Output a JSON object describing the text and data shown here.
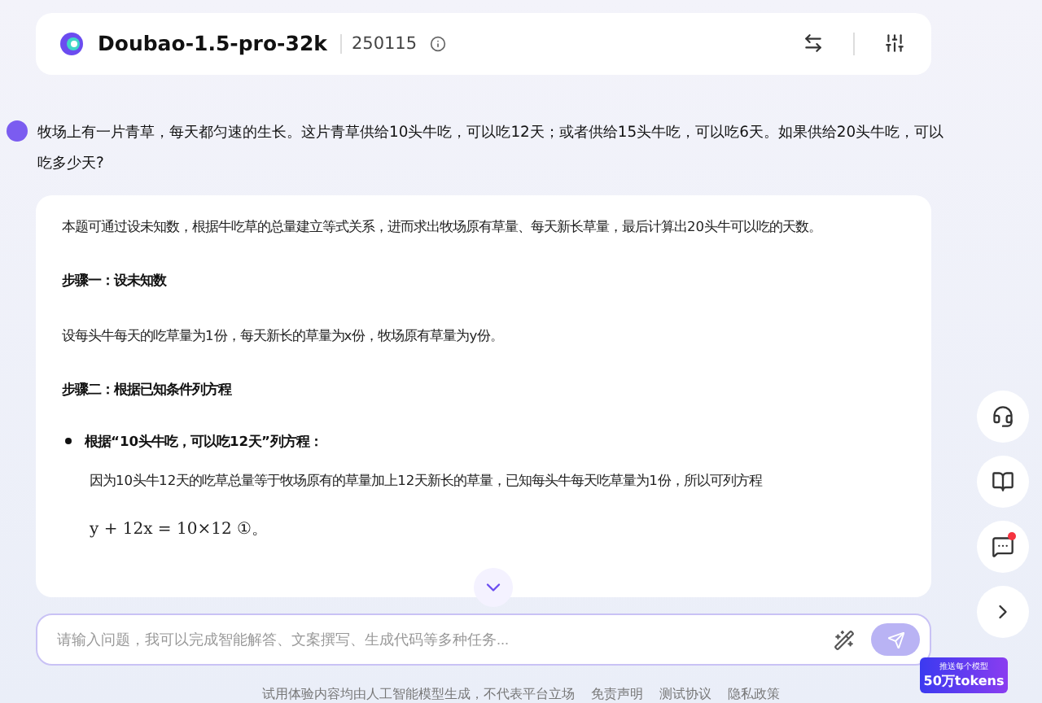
{
  "header": {
    "model_name": "Doubao-1.5-pro-32k",
    "version": "250115"
  },
  "question": {
    "text": "牧场上有一片青草，每天都匀速的生长。这片青草供给10头牛吃，可以吃12天；或者供给15头牛吃，可以吃6天。如果供给20头牛吃，可以吃多少天?"
  },
  "answer": {
    "blocks": [
      {
        "kind": "paragraph",
        "text": "本题可通过设未知数，根据牛吃草的总量建立等式关系，进而求出牧场原有草量、每天新长草量，最后计算出20头牛可以吃的天数。"
      },
      {
        "kind": "heading",
        "text": "步骤一：设未知数"
      },
      {
        "kind": "paragraph",
        "text": "设每头牛每天的吃草量为1份，每天新长的草量为x份，牧场原有草量为y份。"
      },
      {
        "kind": "heading",
        "text": "步骤二：根据已知条件列方程"
      },
      {
        "kind": "bullet",
        "text": "根据“10头牛吃，可以吃12天”列方程："
      },
      {
        "kind": "indented",
        "text": "因为10头牛12天的吃草总量等于牧场原有的草量加上12天新长的草量，已知每头牛每天吃草量为1份，所以可列方程"
      },
      {
        "kind": "formula",
        "text": "y + 12x = 10×12",
        "tag": "①",
        "end": "。"
      }
    ]
  },
  "input": {
    "placeholder": "请输入问题，我可以完成智能解答、文案撰写、生成代码等多种任务..."
  },
  "promo": {
    "line1": "推送每个模型",
    "line2": "50万tokens"
  },
  "side_buttons": [
    {
      "kind": "headset",
      "badge": false
    },
    {
      "kind": "book",
      "badge": false
    },
    {
      "kind": "feedback",
      "badge": true
    },
    {
      "kind": "expand",
      "badge": false
    }
  ],
  "footer": {
    "text": "试用体验内容均由人工智能模型生成，不代表平台立场",
    "links": [
      "免责声明",
      "测试协议",
      "隐私政策"
    ]
  }
}
